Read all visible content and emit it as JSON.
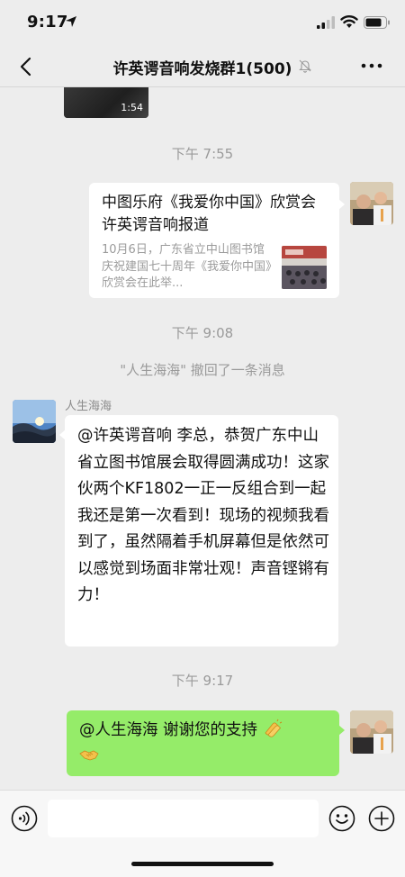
{
  "status": {
    "time": "9:17"
  },
  "nav": {
    "title": "许英谔音响发烧群1(500)"
  },
  "video": {
    "duration": "1:54"
  },
  "timestamps": [
    "下午 7:55",
    "下午 9:08",
    "下午 9:17"
  ],
  "card": {
    "title": "中图乐府《我爱你中国》欣赏会许英谔音响报道",
    "description": "10月6日，广东省立中山图书馆庆祝建国七十周年《我爱你中国》欣赏会在此举..."
  },
  "recall_notice": "\"人生海海\" 撤回了一条消息",
  "peer": {
    "name": "人生海海",
    "message": "@许英谔音响 李总，恭贺广东中山省立图书馆展会取得圆满成功！这家伙两个KF1802一正一反组合到一起我还是第一次看到！现场的视频我看到了，虽然隔着手机屏幕但是依然可以感觉到场面非常壮观！声音铿锵有力！"
  },
  "my_reply": {
    "text": "@人生海海 谢谢您的支持"
  },
  "colors": {
    "bubble_out": "#95ec69",
    "background": "#ededed"
  }
}
